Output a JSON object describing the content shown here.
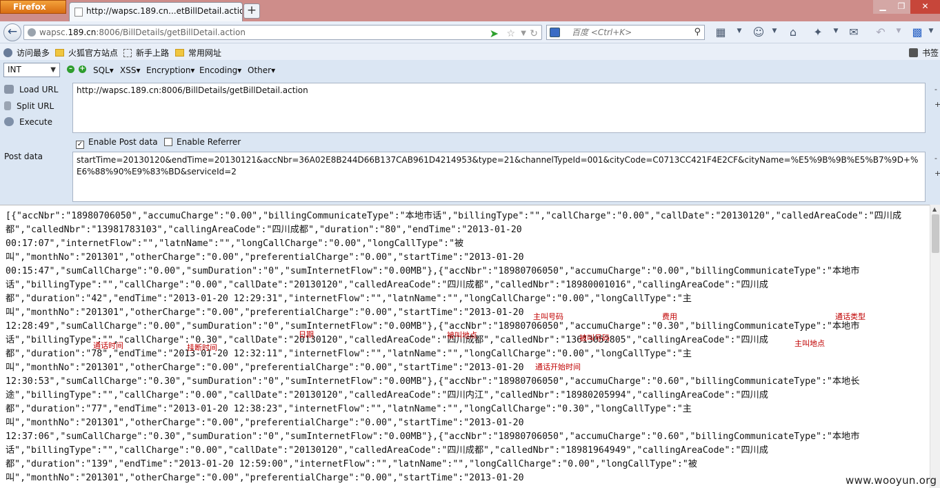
{
  "window": {
    "menu_button": "Firefox",
    "tab_title": "http://wapsc.189.cn...etBillDetail.action",
    "new_tab": "+",
    "minimize": "▁",
    "maximize": "❐",
    "close": "✕"
  },
  "nav": {
    "url_prefix": "wapsc.",
    "url_domain": "189.cn",
    "url_rest": ":8006/BillDetails/getBillDetail.action",
    "search_placeholder": "百度 <Ctrl+K>"
  },
  "bookmarks": [
    "访问最多",
    "火狐官方站点",
    "新手上路",
    "常用网址"
  ],
  "bookmarks_right": "书签",
  "hackbar": {
    "type_select": "INT",
    "menus": [
      "SQL▾",
      "XSS▾",
      "Encryption▾",
      "Encoding▾",
      "Other▾"
    ],
    "actions": [
      "Load URL",
      "Split URL",
      "Execute"
    ],
    "url_value": "http://wapsc.189.cn:8006/BillDetails/getBillDetail.action",
    "enable_post": "Enable Post data",
    "enable_referrer": "Enable Referrer",
    "post_label": "Post data",
    "post_value": "startTime=20130120&endTime=20130121&accNbr=36A02E8B244D66B137CAB961D4214953&type=21&channelTypeId=001&cityCode=C0713CC421F4E2CF&cityName=%E5%9B%9B%E5%B7%9D+%E6%88%90%E9%83%BD&serviceId=2"
  },
  "response_lines": [
    "[{\"accNbr\":\"18980706050\",\"accumuCharge\":\"0.00\",\"billingCommunicateType\":\"本地市话\",\"billingType\":\"\",\"callCharge\":\"0.00\",\"callDate\":\"20130120\",\"calledAreaCode\":\"四川成",
    "都\",\"calledNbr\":\"13981783103\",\"callingAreaCode\":\"四川成都\",\"duration\":\"80\",\"endTime\":\"2013-01-20",
    "00:17:07\",\"internetFlow\":\"\",\"latnName\":\"\",\"longCallCharge\":\"0.00\",\"longCallType\":\"被",
    "叫\",\"monthNo\":\"201301\",\"otherCharge\":\"0.00\",\"preferentialCharge\":\"0.00\",\"startTime\":\"2013-01-20",
    "00:15:47\",\"sumCallCharge\":\"0.00\",\"sumDuration\":\"0\",\"sumInternetFlow\":\"0.00MB\"},{\"accNbr\":\"18980706050\",\"accumuCharge\":\"0.00\",\"billingCommunicateType\":\"本地市",
    "话\",\"billingType\":\"\",\"callCharge\":\"0.00\",\"callDate\":\"20130120\",\"calledAreaCode\":\"四川成都\",\"calledNbr\":\"18980001016\",\"callingAreaCode\":\"四川成",
    "都\",\"duration\":\"42\",\"endTime\":\"2013-01-20 12:29:31\",\"internetFlow\":\"\",\"latnName\":\"\",\"longCallCharge\":\"0.00\",\"longCallType\":\"主",
    "叫\",\"monthNo\":\"201301\",\"otherCharge\":\"0.00\",\"preferentialCharge\":\"0.00\",\"startTime\":\"2013-01-20",
    "12:28:49\",\"sumCallCharge\":\"0.00\",\"sumDuration\":\"0\",\"sumInternetFlow\":\"0.00MB\"},{\"accNbr\":\"18980706050\",\"accumuCharge\":\"0.30\",\"billingCommunicateType\":\"本地市",
    "话\",\"billingType\":\"\",\"callCharge\":\"0.30\",\"callDate\":\"20130120\",\"calledAreaCode\":\"四川成都\",\"calledNbr\":\"13613052805\",\"callingAreaCode\":\"四川成",
    "都\",\"duration\":\"78\",\"endTime\":\"2013-01-20 12:32:11\",\"internetFlow\":\"\",\"latnName\":\"\",\"longCallCharge\":\"0.00\",\"longCallType\":\"主",
    "叫\",\"monthNo\":\"201301\",\"otherCharge\":\"0.00\",\"preferentialCharge\":\"0.00\",\"startTime\":\"2013-01-20",
    "12:30:53\",\"sumCallCharge\":\"0.30\",\"sumDuration\":\"0\",\"sumInternetFlow\":\"0.00MB\"},{\"accNbr\":\"18980706050\",\"accumuCharge\":\"0.60\",\"billingCommunicateType\":\"本地长",
    "途\",\"billingType\":\"\",\"callCharge\":\"0.00\",\"callDate\":\"20130120\",\"calledAreaCode\":\"四川内江\",\"calledNbr\":\"18980205994\",\"callingAreaCode\":\"四川成",
    "都\",\"duration\":\"77\",\"endTime\":\"2013-01-20 12:38:23\",\"internetFlow\":\"\",\"latnName\":\"\",\"longCallCharge\":\"0.30\",\"longCallType\":\"主",
    "叫\",\"monthNo\":\"201301\",\"otherCharge\":\"0.00\",\"preferentialCharge\":\"0.00\",\"startTime\":\"2013-01-20",
    "12:37:06\",\"sumCallCharge\":\"0.30\",\"sumDuration\":\"0\",\"sumInternetFlow\":\"0.00MB\"},{\"accNbr\":\"18980706050\",\"accumuCharge\":\"0.60\",\"billingCommunicateType\":\"本地市",
    "话\",\"billingType\":\"\",\"callCharge\":\"0.00\",\"callDate\":\"20130120\",\"calledAreaCode\":\"四川成都\",\"calledNbr\":\"18981964949\",\"callingAreaCode\":\"四川成",
    "都\",\"duration\":\"139\",\"endTime\":\"2013-01-20 12:59:00\",\"internetFlow\":\"\",\"latnName\":\"\",\"longCallCharge\":\"0.00\",\"longCallType\":\"被",
    "叫\",\"monthNo\":\"201301\",\"otherCharge\":\"0.00\",\"preferentialCharge\":\"0.00\",\"startTime\":\"2013-01-20"
  ],
  "annotations": {
    "caller_number": "主叫号码",
    "fee": "费用",
    "call_type": "通话类型",
    "date": "日期",
    "called_area": "被叫地点",
    "called_number": "被叫号码",
    "caller_area": "主叫地点",
    "call_duration": "通话时间",
    "end_time": "挂断时间",
    "start_time": "通话开始时间"
  },
  "watermark": "www.wooyun.org",
  "colors": {
    "annotation": "#c00000",
    "titlebar": "#ce8d8a",
    "toolbar": "#dbe6f3"
  }
}
